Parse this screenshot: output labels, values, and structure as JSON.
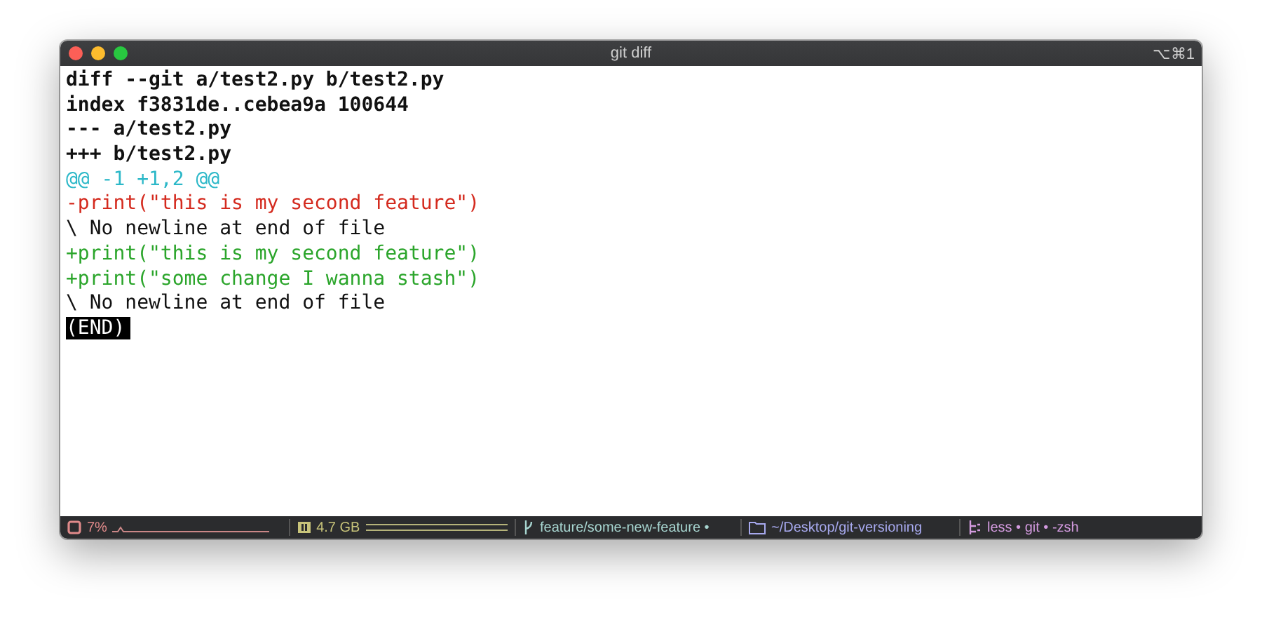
{
  "window": {
    "title": "git diff",
    "shortcut": "⌥⌘1"
  },
  "lines": [
    {
      "kind": "header",
      "text": "diff --git a/test2.py b/test2.py"
    },
    {
      "kind": "header",
      "text": "index f3831de..cebea9a 100644"
    },
    {
      "kind": "header",
      "text": "--- a/test2.py"
    },
    {
      "kind": "header",
      "text": "+++ b/test2.py"
    },
    {
      "kind": "hunk",
      "text": "@@ -1 +1,2 @@"
    },
    {
      "kind": "removed",
      "text": "-print(\"this is my second feature\")"
    },
    {
      "kind": "plain",
      "text": "\\ No newline at end of file"
    },
    {
      "kind": "added",
      "text": "+print(\"this is my second feature\")"
    },
    {
      "kind": "added",
      "text": "+print(\"some change I wanna stash\")"
    },
    {
      "kind": "plain",
      "text": "\\ No newline at end of file"
    },
    {
      "kind": "end",
      "text": "(END)"
    }
  ],
  "status_bar": {
    "cpu": "7%",
    "memory": "4.7 GB",
    "branch": "feature/some-new-feature •",
    "path": "~/Desktop/git-versioning",
    "processes": "less • git • -zsh"
  }
}
